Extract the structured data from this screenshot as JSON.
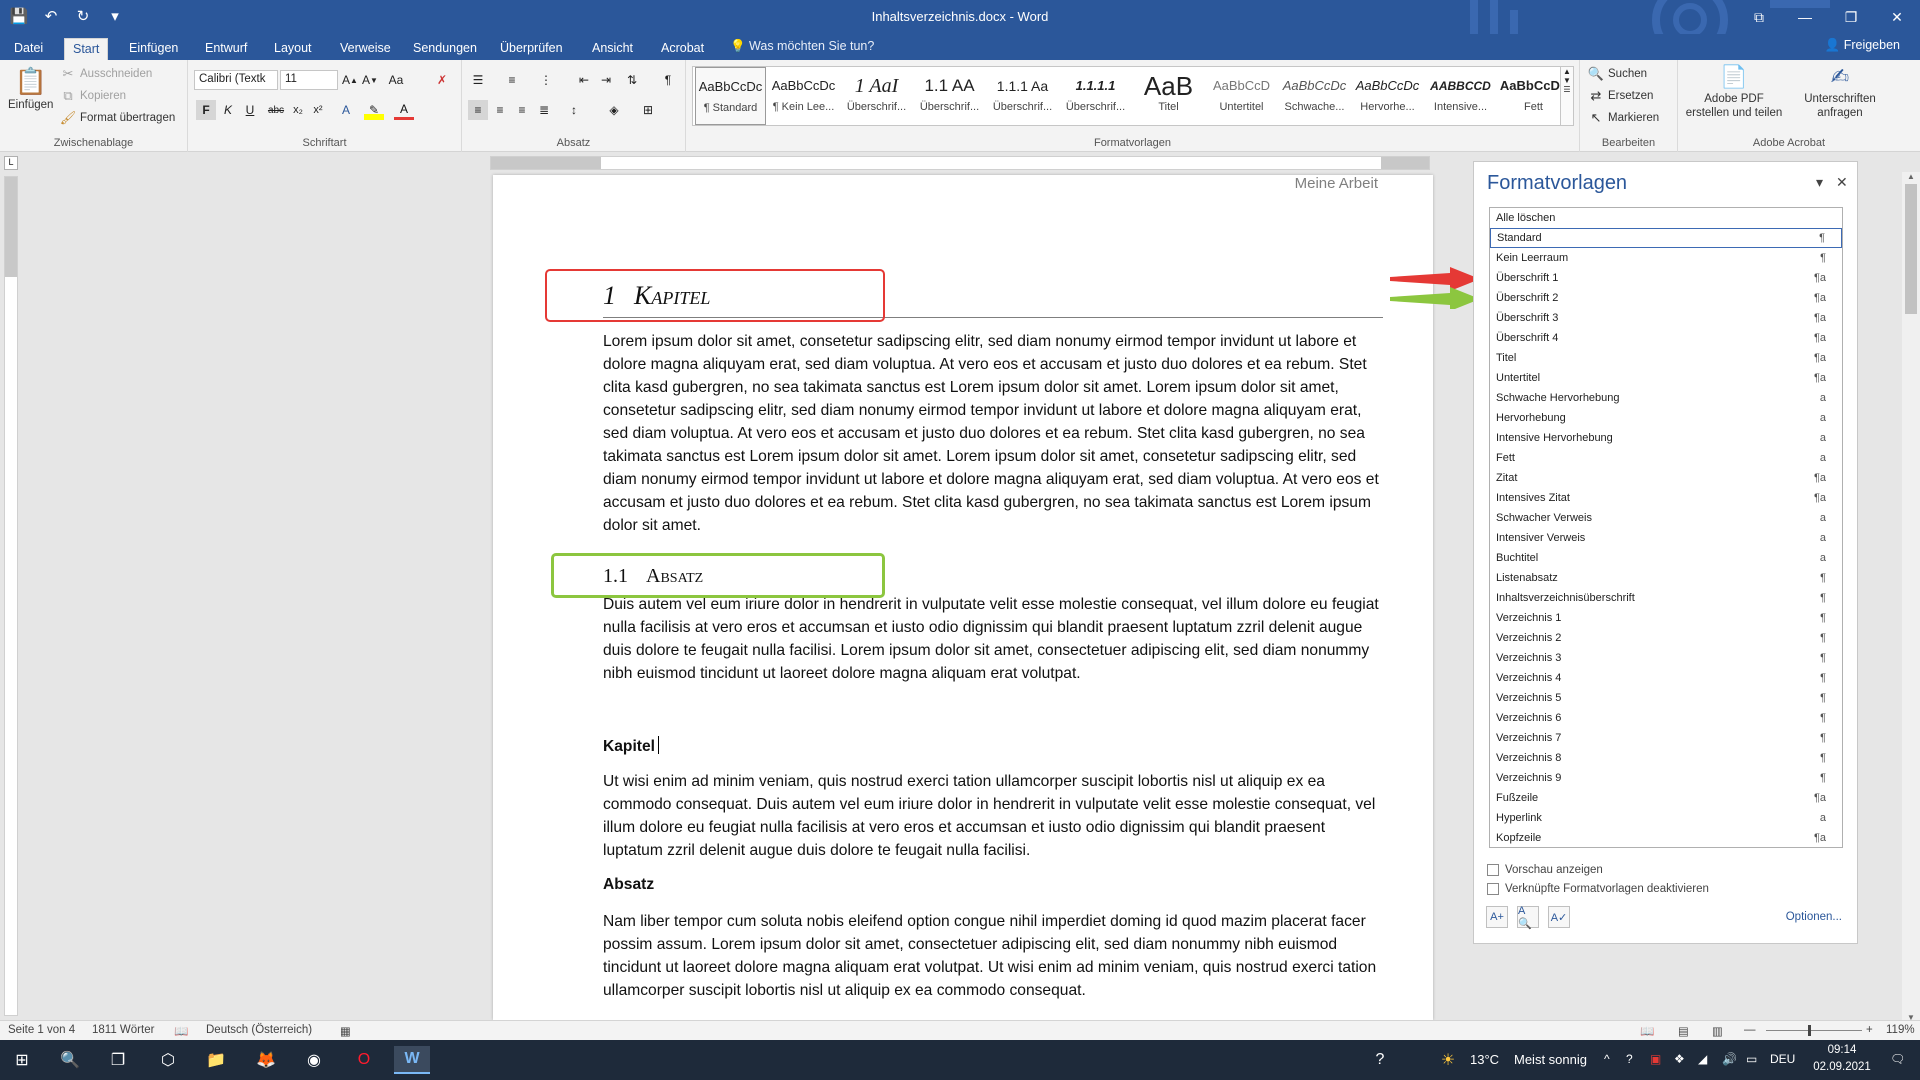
{
  "window": {
    "title": "Inhaltsverzeichnis.docx - Word",
    "quick_access": {
      "save_glyph": "💾",
      "undo_glyph": "↶",
      "redo_glyph": "↻",
      "more_glyph": "▾"
    },
    "controls": {
      "restore_glyph": "⧉",
      "minimize_glyph": "—",
      "maximize_glyph": "❐",
      "close_glyph": "✕"
    }
  },
  "tabs": [
    "Datei",
    "Start",
    "Einfügen",
    "Entwurf",
    "Layout",
    "Verweise",
    "Sendungen",
    "Überprüfen",
    "Ansicht",
    "Acrobat"
  ],
  "active_tab": "Start",
  "tell_me": "Was möchten Sie tun?",
  "share": "Freigeben",
  "ribbon": {
    "clipboard": {
      "label": "Zwischenablage",
      "paste": "Einfügen",
      "cut": "Ausschneiden",
      "copy": "Kopieren",
      "format_painter": "Format übertragen"
    },
    "font": {
      "label": "Schriftart",
      "font_name": "Calibri (Textk",
      "font_size": "11"
    },
    "paragraph": {
      "label": "Absatz"
    },
    "styles": {
      "label": "Formatvorlagen",
      "tiles": [
        {
          "preview": "AaBbCcDc",
          "name": "¶ Standard"
        },
        {
          "preview": "AaBbCcDc",
          "name": "¶ Kein Lee..."
        },
        {
          "preview": "1  AaI",
          "name": "Überschrif..."
        },
        {
          "preview": "1.1  AA",
          "name": "Überschrif..."
        },
        {
          "preview": "1.1.1  Aa",
          "name": "Überschrif..."
        },
        {
          "preview": "1.1.1.1",
          "name": "Überschrif..."
        },
        {
          "preview": "AaB",
          "name": "Titel"
        },
        {
          "preview": "AaBbCcD",
          "name": "Untertitel"
        },
        {
          "preview": "AaBbCcDc",
          "name": "Schwache..."
        },
        {
          "preview": "AaBbCcDc",
          "name": "Hervorhe..."
        },
        {
          "preview": "AABBCCD",
          "name": "Intensive..."
        },
        {
          "preview": "AaBbCcDc",
          "name": "Fett"
        }
      ]
    },
    "editing": {
      "label": "Bearbeiten",
      "find": "Suchen",
      "replace": "Ersetzen",
      "select": "Markieren"
    },
    "acrobat": {
      "label": "Adobe Acrobat",
      "create_pdf": "Adobe PDF erstellen und teilen",
      "request_sign": "Unterschriften anfragen"
    }
  },
  "document": {
    "header": "Meine Arbeit",
    "h1_number": "1",
    "h1_text": "Kapitel",
    "para1": "Lorem ipsum dolor sit amet, consetetur sadipscing elitr, sed diam nonumy eirmod tempor invidunt ut labore et dolore magna aliquyam erat, sed diam voluptua. At vero eos et accusam et justo duo dolores et ea rebum. Stet clita kasd gubergren, no sea takimata sanctus est Lorem ipsum dolor sit amet. Lorem ipsum dolor sit amet, consetetur sadipscing elitr, sed diam nonumy eirmod tempor invidunt ut labore et dolore magna aliquyam erat, sed diam voluptua. At vero eos et accusam et justo duo dolores et ea rebum. Stet clita kasd gubergren, no sea takimata sanctus est Lorem ipsum dolor sit amet. Lorem ipsum dolor sit amet, consetetur sadipscing elitr, sed diam nonumy eirmod tempor invidunt ut labore et dolore magna aliquyam erat, sed diam voluptua. At vero eos et accusam et justo duo dolores et ea rebum. Stet clita kasd gubergren, no sea takimata sanctus est Lorem ipsum dolor sit amet.",
    "h2_number": "1.1",
    "h2_text": "Absatz",
    "para2": "Duis autem vel eum iriure dolor in hendrerit in vulputate velit esse molestie consequat, vel illum dolore eu feugiat nulla facilisis at vero eros et accumsan et iusto odio dignissim qui blandit praesent luptatum zzril delenit augue duis dolore te feugait nulla facilisi. Lorem ipsum dolor sit amet, consectetuer adipiscing elit, sed diam nonummy nibh euismod tincidunt ut laoreet dolore magna aliquam erat volutpat.",
    "bold1": "Kapitel",
    "para3": "Ut wisi enim ad minim veniam, quis nostrud exerci tation ullamcorper suscipit lobortis nisl ut aliquip ex ea commodo consequat. Duis autem vel eum iriure dolor in hendrerit in vulputate velit esse molestie consequat, vel illum dolore eu feugiat nulla facilisis at vero eros et accumsan et iusto odio dignissim qui blandit praesent luptatum zzril delenit augue duis dolore te feugait nulla facilisi.",
    "bold2": "Absatz",
    "para4": "Nam liber tempor cum soluta nobis eleifend option congue nihil imperdiet doming id quod mazim placerat facer possim assum. Lorem ipsum dolor sit amet, consectetuer adipiscing elit, sed diam nonummy nibh euismod tincidunt ut laoreet dolore magna aliquam erat volutpat. Ut wisi enim ad minim veniam, quis nostrud exerci tation ullamcorper suscipit lobortis nisl ut aliquip ex ea commodo consequat."
  },
  "styles_pane": {
    "title": "Formatvorlagen",
    "clear_all": "Alle löschen",
    "items": [
      {
        "name": "Standard",
        "glyph": "¶",
        "selected": true
      },
      {
        "name": "Kein Leerraum",
        "glyph": "¶"
      },
      {
        "name": "Überschrift 1",
        "glyph": "¶a"
      },
      {
        "name": "Überschrift 2",
        "glyph": "¶a"
      },
      {
        "name": "Überschrift 3",
        "glyph": "¶a"
      },
      {
        "name": "Überschrift 4",
        "glyph": "¶a"
      },
      {
        "name": "Titel",
        "glyph": "¶a"
      },
      {
        "name": "Untertitel",
        "glyph": "¶a"
      },
      {
        "name": "Schwache Hervorhebung",
        "glyph": "a"
      },
      {
        "name": "Hervorhebung",
        "glyph": "a"
      },
      {
        "name": "Intensive Hervorhebung",
        "glyph": "a"
      },
      {
        "name": "Fett",
        "glyph": "a"
      },
      {
        "name": "Zitat",
        "glyph": "¶a"
      },
      {
        "name": "Intensives Zitat",
        "glyph": "¶a"
      },
      {
        "name": "Schwacher Verweis",
        "glyph": "a"
      },
      {
        "name": "Intensiver Verweis",
        "glyph": "a"
      },
      {
        "name": "Buchtitel",
        "glyph": "a"
      },
      {
        "name": "Listenabsatz",
        "glyph": "¶"
      },
      {
        "name": "Inhaltsverzeichnisüberschrift",
        "glyph": "¶"
      },
      {
        "name": "Verzeichnis 1",
        "glyph": "¶"
      },
      {
        "name": "Verzeichnis 2",
        "glyph": "¶"
      },
      {
        "name": "Verzeichnis 3",
        "glyph": "¶"
      },
      {
        "name": "Verzeichnis 4",
        "glyph": "¶"
      },
      {
        "name": "Verzeichnis 5",
        "glyph": "¶"
      },
      {
        "name": "Verzeichnis 6",
        "glyph": "¶"
      },
      {
        "name": "Verzeichnis 7",
        "glyph": "¶"
      },
      {
        "name": "Verzeichnis 8",
        "glyph": "¶"
      },
      {
        "name": "Verzeichnis 9",
        "glyph": "¶"
      },
      {
        "name": "Fußzeile",
        "glyph": "¶a"
      },
      {
        "name": "Hyperlink",
        "glyph": "a"
      },
      {
        "name": "Kopfzeile",
        "glyph": "¶a"
      }
    ],
    "show_preview": "Vorschau anzeigen",
    "disable_linked": "Verknüpfte Formatvorlagen deaktivieren",
    "options": "Optionen..."
  },
  "status": {
    "page": "Seite 1 von 4",
    "words": "1811 Wörter",
    "language": "Deutsch (Österreich)",
    "zoom": "119%"
  },
  "taskbar": {
    "weather_temp": "13°C",
    "weather_text": "Meist sonnig",
    "lang": "DEU",
    "time": "09:14",
    "date": "02.09.2021"
  },
  "colors": {
    "word_blue": "#2b579a",
    "annotation_red": "#e53935",
    "annotation_green": "#8cc63f"
  }
}
